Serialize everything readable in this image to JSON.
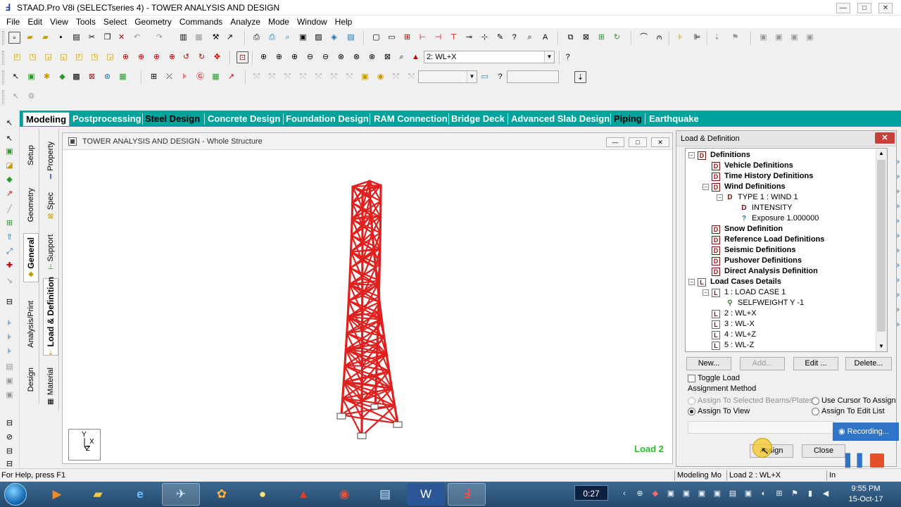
{
  "window": {
    "title": "STAAD.Pro V8i (SELECTseries 4) - TOWER ANALYSIS AND DESIGN",
    "min_glyph": "—",
    "max_glyph": "□",
    "close_glyph": "✕"
  },
  "menu": [
    "File",
    "Edit",
    "View",
    "Tools",
    "Select",
    "Geometry",
    "Commands",
    "Analyze",
    "Mode",
    "Window",
    "Help"
  ],
  "toolbar": {
    "load_combo_value": "2: WL+X",
    "help_glyph": "?"
  },
  "mode_tabs": [
    "Modeling",
    "Postprocessing",
    "Steel Design",
    "Concrete Design",
    "Foundation Design",
    "RAM Connection",
    "Bridge Deck",
    "Advanced Slab Design",
    "Piping",
    "Earthquake"
  ],
  "page_control": {
    "outer_tabs": [
      "Setup",
      "Geometry",
      "General",
      "Analysis/Print",
      "Design"
    ],
    "inner_tabs": [
      "Property",
      "Spec",
      "Support",
      "Load & Definition",
      "Material"
    ]
  },
  "viewport": {
    "title": "TOWER ANALYSIS AND DESIGN - Whole Structure",
    "load_label": "Load 2",
    "axis_y": "Y",
    "axis_x": "X",
    "axis_z": "Z"
  },
  "load_panel": {
    "title": "Load & Definition",
    "close_glyph": "✕",
    "tree": [
      {
        "label": "Definitions",
        "bold": true,
        "icon": "D"
      },
      {
        "label": "Vehicle Definitions",
        "bold": true,
        "icon": "D"
      },
      {
        "label": "Time History Definitions",
        "bold": true,
        "icon": "D"
      },
      {
        "label": "Wind Definitions",
        "bold": true,
        "icon": "D"
      },
      {
        "label": "TYPE 1 : WIND 1",
        "bold": false,
        "icon": "D"
      },
      {
        "label": "INTENSITY",
        "bold": false,
        "icon": "D"
      },
      {
        "label": "Exposure 1.000000",
        "bold": false,
        "icon": "?"
      },
      {
        "label": "Snow Definition",
        "bold": true,
        "icon": "D"
      },
      {
        "label": "Reference Load Definitions",
        "bold": true,
        "icon": "D"
      },
      {
        "label": "Seismic Definitions",
        "bold": true,
        "icon": "D"
      },
      {
        "label": "Pushover Definitions",
        "bold": true,
        "icon": "D"
      },
      {
        "label": "Direct Analysis Definition",
        "bold": true,
        "icon": "D"
      },
      {
        "label": "Load Cases Details",
        "bold": true,
        "icon": "L"
      },
      {
        "label": "1 : LOAD CASE 1",
        "bold": false,
        "icon": "L"
      },
      {
        "label": "SELFWEIGHT Y -1",
        "bold": false,
        "icon": "S"
      },
      {
        "label": "2 : WL+X",
        "bold": false,
        "icon": "L"
      },
      {
        "label": "3 : WL-X",
        "bold": false,
        "icon": "L"
      },
      {
        "label": "4 : WL+Z",
        "bold": false,
        "icon": "L"
      },
      {
        "label": "5 : WL-Z",
        "bold": false,
        "icon": "L"
      }
    ],
    "buttons": {
      "new": "New...",
      "add": "Add...",
      "edit": "Edit ...",
      "delete": "Delete..."
    },
    "toggle_load": "Toggle Load",
    "assignment_method": "Assignment Method",
    "radio": {
      "selected_beams": "Assign To Selected Beams/Plates",
      "view": "Assign To View",
      "cursor": "Use Cursor To Assign",
      "edit_list": "Assign To Edit List"
    },
    "assign": "Assign",
    "close": "Close"
  },
  "recording": {
    "label": "Recording..."
  },
  "statusbar": {
    "help": "For Help, press F1",
    "mode": "Modeling Mo",
    "load": "Load 2 : WL+X",
    "units": "In"
  },
  "taskbar": {
    "timer": "0:27",
    "time": "9:55 PM",
    "date": "15-Oct-17"
  },
  "colors": {
    "mode_bar": "#00a29e",
    "tower": "#e0201e",
    "load_label": "#2bbd2b"
  }
}
